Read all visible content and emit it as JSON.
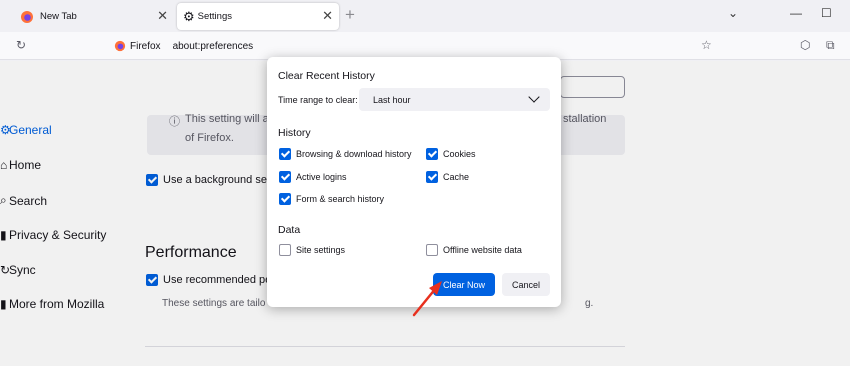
{
  "browser": {
    "tabs": [
      {
        "label": "New Tab",
        "active": false
      },
      {
        "label": "Settings",
        "active": true
      }
    ],
    "url_identity": "Firefox",
    "url": "about:preferences"
  },
  "sidebar": {
    "items": [
      {
        "label": "General",
        "icon": "gear-icon",
        "selected": true
      },
      {
        "label": "Home",
        "icon": "home-icon",
        "selected": false
      },
      {
        "label": "Search",
        "icon": "search-icon",
        "selected": false
      },
      {
        "label": "Privacy & Security",
        "icon": "lock-icon",
        "selected": false
      },
      {
        "label": "Sync",
        "icon": "sync-icon",
        "selected": false
      },
      {
        "label": "More from Mozilla",
        "icon": "mozilla-icon",
        "selected": false
      }
    ]
  },
  "main": {
    "notice_line1": "This setting will a",
    "notice_line1_end": "stallation",
    "notice_line2": "of Firefox.",
    "background_service_label": "Use a background serv",
    "performance_title": "Performance",
    "recommended_label": "Use recommended pe",
    "perf_desc": "These settings are tailo",
    "perf_desc_end": "g."
  },
  "dialog": {
    "title": "Clear Recent History",
    "time_range_label": "Time range to clear:",
    "time_range_value": "Last hour",
    "history_header": "History",
    "history_items": [
      {
        "label": "Browsing & download history",
        "checked": true
      },
      {
        "label": "Cookies",
        "checked": true
      },
      {
        "label": "Active logins",
        "checked": true
      },
      {
        "label": "Cache",
        "checked": true
      },
      {
        "label": "Form & search history",
        "checked": true
      }
    ],
    "data_header": "Data",
    "data_items": [
      {
        "label": "Site settings",
        "checked": false
      },
      {
        "label": "Offline website data",
        "checked": false
      }
    ],
    "clear_button": "Clear Now",
    "cancel_button": "Cancel"
  },
  "colors": {
    "accent": "#0061e0",
    "annotation_arrow": "#e8301e"
  }
}
